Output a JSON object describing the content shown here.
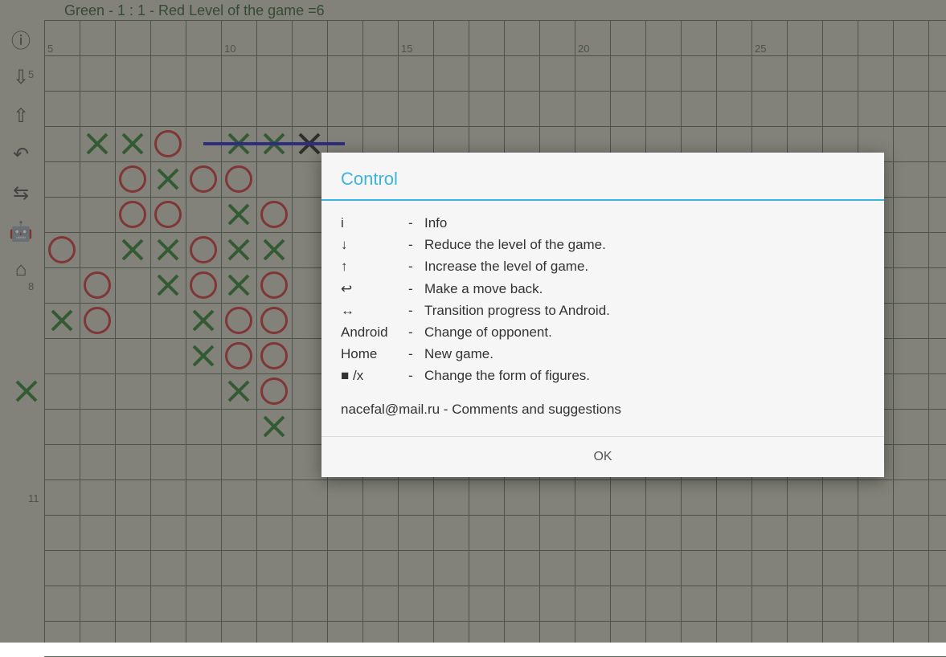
{
  "status": "Green - 1  :  1 - Red    Level of the game =6",
  "grid": {
    "cell": 44,
    "cols": 26,
    "rows": 18
  },
  "axis_x": [
    {
      "label": "5",
      "col": 0
    },
    {
      "label": "10",
      "col": 5
    },
    {
      "label": "15",
      "col": 10
    },
    {
      "label": "20",
      "col": 15
    },
    {
      "label": "25",
      "col": 20
    }
  ],
  "axis_y": [
    {
      "label": "5",
      "row": 0
    },
    {
      "label": "8",
      "row": 6
    },
    {
      "label": "11",
      "row": 12
    }
  ],
  "toolbar": [
    {
      "name": "info-icon",
      "glyph": "ⓘ"
    },
    {
      "name": "down-arrow-icon",
      "glyph": "⇩"
    },
    {
      "name": "up-arrow-icon",
      "glyph": "⇧"
    },
    {
      "name": "undo-icon",
      "glyph": "↶"
    },
    {
      "name": "transfer-icon",
      "glyph": "⇆"
    },
    {
      "name": "android-icon",
      "glyph": "🤖"
    },
    {
      "name": "home-icon",
      "glyph": "⌂"
    }
  ],
  "pieces": [
    {
      "t": "x",
      "c": "green",
      "col": 1,
      "row": 2
    },
    {
      "t": "x",
      "c": "green",
      "col": 2,
      "row": 2
    },
    {
      "t": "o",
      "c": "red",
      "col": 3,
      "row": 2
    },
    {
      "t": "x",
      "c": "green",
      "col": 5,
      "row": 2
    },
    {
      "t": "x",
      "c": "green",
      "col": 6,
      "row": 2
    },
    {
      "t": "x",
      "c": "black",
      "col": 7,
      "row": 2
    },
    {
      "t": "o",
      "c": "red",
      "col": 2,
      "row": 3
    },
    {
      "t": "x",
      "c": "green",
      "col": 3,
      "row": 3
    },
    {
      "t": "o",
      "c": "red",
      "col": 4,
      "row": 3
    },
    {
      "t": "o",
      "c": "red",
      "col": 5,
      "row": 3
    },
    {
      "t": "x",
      "c": "green",
      "col": 9,
      "row": 3
    },
    {
      "t": "o",
      "c": "red",
      "col": 2,
      "row": 4
    },
    {
      "t": "o",
      "c": "red",
      "col": 3,
      "row": 4
    },
    {
      "t": "x",
      "c": "green",
      "col": 5,
      "row": 4
    },
    {
      "t": "o",
      "c": "red",
      "col": 6,
      "row": 4
    },
    {
      "t": "o",
      "c": "red",
      "col": 0,
      "row": 5
    },
    {
      "t": "x",
      "c": "green",
      "col": 2,
      "row": 5
    },
    {
      "t": "x",
      "c": "green",
      "col": 3,
      "row": 5
    },
    {
      "t": "o",
      "c": "red",
      "col": 4,
      "row": 5
    },
    {
      "t": "x",
      "c": "green",
      "col": 5,
      "row": 5
    },
    {
      "t": "x",
      "c": "green",
      "col": 6,
      "row": 5
    },
    {
      "t": "o",
      "c": "red",
      "col": 1,
      "row": 6
    },
    {
      "t": "x",
      "c": "green",
      "col": 3,
      "row": 6
    },
    {
      "t": "o",
      "c": "red",
      "col": 4,
      "row": 6
    },
    {
      "t": "x",
      "c": "green",
      "col": 5,
      "row": 6
    },
    {
      "t": "o",
      "c": "red",
      "col": 6,
      "row": 6
    },
    {
      "t": "x",
      "c": "green",
      "col": 0,
      "row": 7
    },
    {
      "t": "o",
      "c": "red",
      "col": 1,
      "row": 7
    },
    {
      "t": "x",
      "c": "green",
      "col": 4,
      "row": 7
    },
    {
      "t": "o",
      "c": "red",
      "col": 5,
      "row": 7
    },
    {
      "t": "o",
      "c": "red",
      "col": 6,
      "row": 7
    },
    {
      "t": "x",
      "c": "green",
      "col": 4,
      "row": 8
    },
    {
      "t": "o",
      "c": "red",
      "col": 5,
      "row": 8
    },
    {
      "t": "o",
      "c": "red",
      "col": 6,
      "row": 8
    },
    {
      "t": "x",
      "c": "green",
      "col": -1,
      "row": 9
    },
    {
      "t": "x",
      "c": "green",
      "col": 5,
      "row": 9
    },
    {
      "t": "o",
      "c": "red",
      "col": 6,
      "row": 9
    },
    {
      "t": "x",
      "c": "green",
      "col": 6,
      "row": 10
    }
  ],
  "winline": {
    "col_start": 4,
    "col_end": 8,
    "row": 2
  },
  "dialog": {
    "title": "Control",
    "rows": [
      {
        "key": "i",
        "dash": "-",
        "val": "Info"
      },
      {
        "key": "↓",
        "dash": "-",
        "val": "Reduce the level of the game."
      },
      {
        "key": "↑",
        "dash": "-",
        "val": "Increase the level of game."
      },
      {
        "key": "↩",
        "dash": "-",
        "val": "Make a move back."
      },
      {
        "key": "↔",
        "dash": "-",
        "val": "Transition progress to Android."
      },
      {
        "key": "Android",
        "dash": "-",
        "val": "Change of opponent."
      },
      {
        "key": "Home",
        "dash": "-",
        "val": "New game."
      },
      {
        "key": "■ /x",
        "dash": "-",
        "val": "Change the form of figures."
      }
    ],
    "footer_text": "nacefal@mail.ru - Comments and suggestions",
    "ok": "OK"
  }
}
